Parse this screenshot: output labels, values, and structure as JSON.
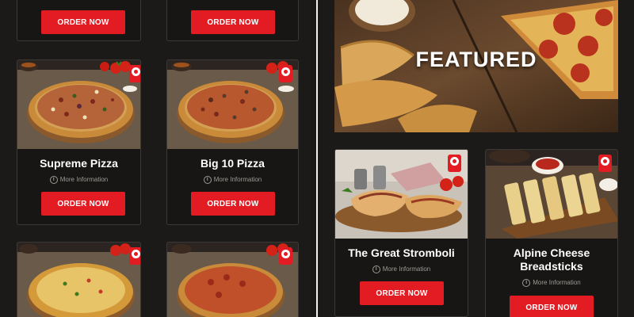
{
  "menu": {
    "order_label": "ORDER NOW",
    "info_label": "More Information",
    "info_icon": "i",
    "items": [
      {
        "title": "Supreme Pizza"
      },
      {
        "title": "Big 10 Pizza"
      }
    ]
  },
  "featured": {
    "heading": "FEATURED",
    "items": [
      {
        "title": "The Great Stromboli"
      },
      {
        "title": "Alpine Cheese Breadsticks"
      }
    ]
  },
  "colors": {
    "accent": "#e31c23",
    "background": "#1b1a18",
    "card_border": "#3b3936",
    "muted_text": "#9c9a96"
  }
}
